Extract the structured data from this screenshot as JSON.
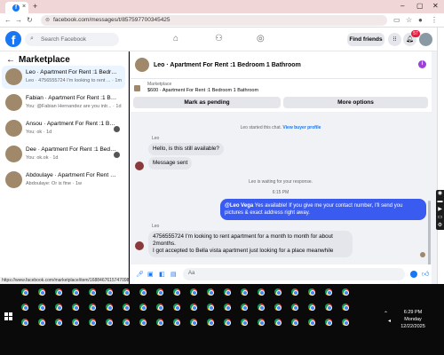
{
  "browser": {
    "tab_favicon": "f",
    "tab_close": "×",
    "new_tab": "+",
    "url": "facebook.com/messages/t/857597700345425",
    "status_url": "https://www.facebook.com/marketplace/item/1688467615747098/?referralSur..."
  },
  "fb": {
    "logo": "f",
    "search_placeholder": "Search Facebook",
    "find_friends": "Find friends",
    "notif_count": "57"
  },
  "left": {
    "title": "Marketplace",
    "conversations": [
      {
        "title": "Leo · Apartment For Rent :1 Bedroo...",
        "sub": "Leo · 4756555724 I'm looking to rent ... · 1m",
        "active": true
      },
      {
        "title": "Fabian · Apartment For Rent :1 Bedro...",
        "sub": "You: @Fabian Hernandez are you intr... · 1d",
        "active": false
      },
      {
        "title": "Ansou · Apartment For Rent :1 Bed...",
        "sub": "You: ok · 1d",
        "active": false
      },
      {
        "title": "Dee · Apartment For Rent :1 Bedro...",
        "sub": "You: ok.ok · 1d",
        "active": false
      },
      {
        "title": "Abdoulaye · Apartment For Rent :1 Be...",
        "sub": "Abdoulaye: Or is fine · 1w",
        "active": false
      }
    ]
  },
  "chat": {
    "title": "Leo · Apartment For Rent :1 Bedroom 1 Bathroom",
    "info": "i",
    "marketplace_label": "Marketplace",
    "listing": "$600 · Apartment For Rent :1 Bedroom 1 Bathroom",
    "btn_pending": "Mark as pending",
    "btn_more": "More options",
    "sys_started": "Leo started this chat.",
    "sys_link": "View buyer profile",
    "sender1": "Leo",
    "msg1": "Hello, is this still available?",
    "msg2": "Message sent",
    "sys_waiting": "Leo is waiting for your response.",
    "time": "6:15 PM",
    "out_mention": "@Leo Vega",
    "out_text": " Yes available! If you give me your contact number, I'll send you pictures & exact address right away.",
    "sender2": "Leo",
    "msg3_line1": "4756555724 I'm looking to rent apartment for a month to month for about 2months.",
    "msg3_line2": "I got accepted to Bella vista apartment just looking for a place meanwhile",
    "composer_placeholder": "Aa"
  },
  "taskbar": {
    "time": "6:29 PM",
    "day": "Monday",
    "date": "12/22/2025"
  },
  "colors": {
    "fb_blue": "#1877f2",
    "out_bubble": "#3a5bf0",
    "badge_red": "#e41e3f"
  }
}
